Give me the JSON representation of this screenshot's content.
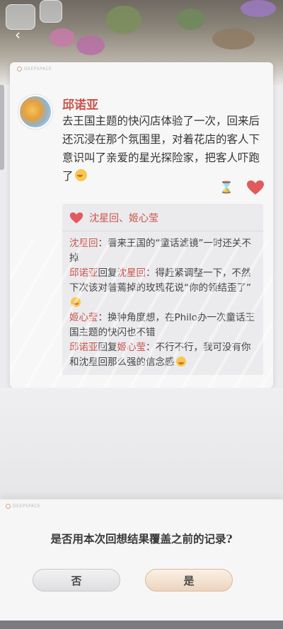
{
  "post": {
    "author": "邱诺亚",
    "text": "去王国主题的快闪店体验了一次，回来后还沉浸在那个氛围里，对着花店的客人下意识叫了亲爱的星光探险家，把客人吓跑了",
    "brand": "DEEPSPACE"
  },
  "likes": {
    "names": "沈星回、姬心莹"
  },
  "comments": [
    {
      "name": "沈星回",
      "text": "：看来王国的“童话滤镜”一时还关不掉"
    },
    {
      "name": "邱诺亚",
      "reply_word": "回复",
      "reply_to": "沈星回",
      "text": "：得赶紧调整一下，不然下次该对着蔫掉的玫瑰花说“你的领结歪了”"
    },
    {
      "name": "姬心莹",
      "text": "：换种角度想，在Philo办一次童话王国主题的快闪也不错"
    },
    {
      "name": "邱诺亚",
      "reply_word": "回复",
      "reply_to": "姬心莹",
      "text": "：不行不行，我可没有你和沈星回那么强的信念感"
    }
  ],
  "dialog": {
    "brand": "DEEPSPACE",
    "question": "是否用本次回想结果覆盖之前的记录?",
    "no_label": "否",
    "yes_label": "是"
  },
  "colors": {
    "accent_red": "#c9534a",
    "heart": "#e05a5e"
  }
}
